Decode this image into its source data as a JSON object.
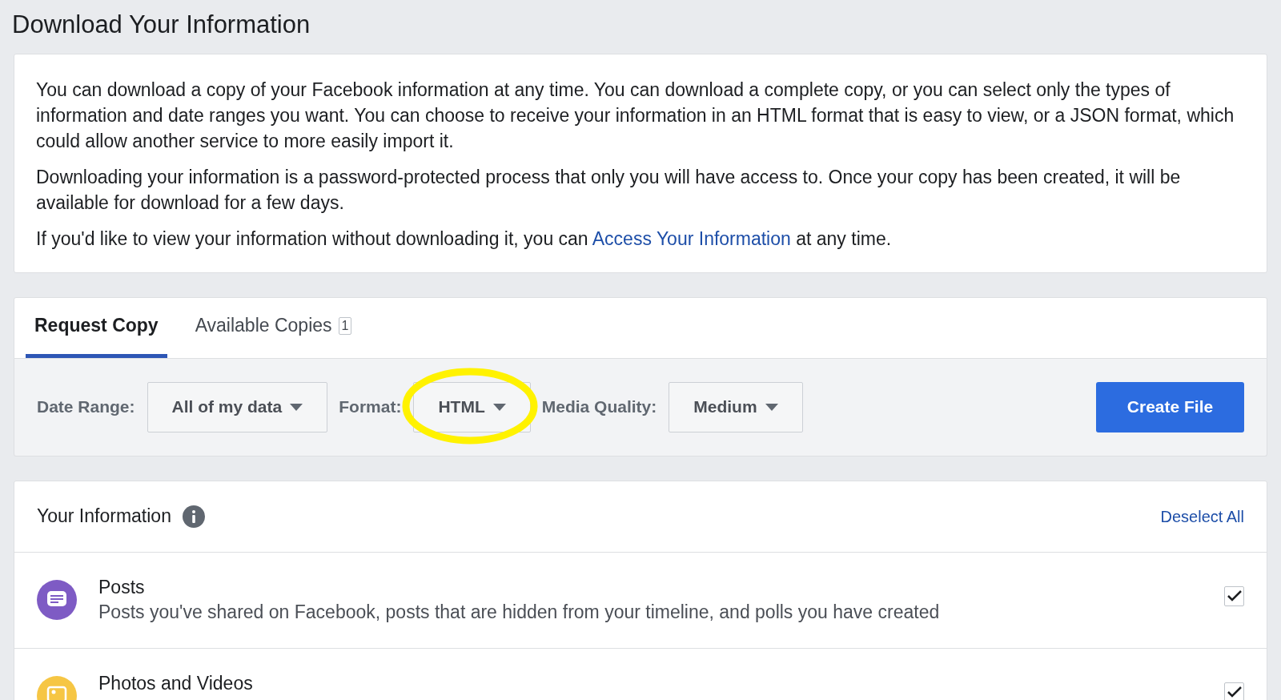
{
  "title": "Download Your Information",
  "intro": [
    "You can download a copy of your Facebook information at any time. You can download a complete copy, or you can select only the types of information and date ranges you want. You can choose to receive your information in an HTML format that is easy to view, or a JSON format, which could allow another service to more easily import it.",
    "Downloading your information is a password-protected process that only you will have access to. Once your copy has been created, it will be available for download for a few days."
  ],
  "access_line": {
    "before": "If you'd like to view your information without downloading it, you can",
    "link": "Access Your Information",
    "after": "at any time."
  },
  "tabs": [
    {
      "label": "Request Copy",
      "selected": true
    },
    {
      "label": "Available Copies",
      "count": "1",
      "selected": false
    }
  ],
  "options": [
    {
      "label": "Date Range:",
      "value": "All of my data",
      "highlighted": false
    },
    {
      "label": "Format:",
      "value": "HTML",
      "highlighted": true
    },
    {
      "label": "Media Quality:",
      "value": "Medium",
      "highlighted": false
    }
  ],
  "create_button": "Create File",
  "info": {
    "title": "Your Information",
    "deselect": "Deselect All",
    "items": [
      {
        "kind": "posts",
        "title": "Posts",
        "description": "Posts you've shared on Facebook, posts that are hidden from your timeline, and polls you have created",
        "color": "#7e5bc4",
        "checked": true
      },
      {
        "kind": "photos",
        "title": "Photos and Videos",
        "color": "#f6c644",
        "checked": true
      }
    ]
  }
}
